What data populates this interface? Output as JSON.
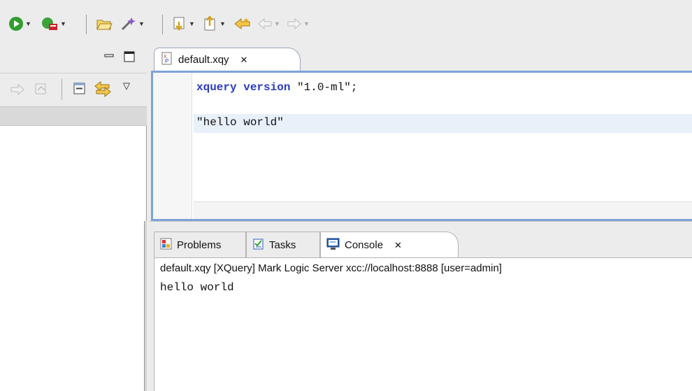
{
  "toolbar": {
    "icons": [
      "run-icon",
      "debug-server-icon",
      "open-folder-icon",
      "wand-icon",
      "next-annotation-icon",
      "prev-annotation-icon",
      "last-edit-icon",
      "back-icon",
      "forward-icon"
    ]
  },
  "left_panel": {
    "icons": [
      "minimize-icon",
      "maximize-icon",
      "forward-nav-icon",
      "home-icon",
      "collapse-all-icon",
      "link-editor-icon",
      "view-menu-icon"
    ]
  },
  "editor": {
    "tab_label": "default.xqy",
    "lines": [
      {
        "keyword": "xquery version",
        "rest": " \"1.0-ml\";"
      },
      {
        "text": "\"hello world\""
      }
    ]
  },
  "views": {
    "tabs": [
      {
        "label": "Problems",
        "icon": "problems-icon"
      },
      {
        "label": "Tasks",
        "icon": "tasks-icon"
      },
      {
        "label": "Console",
        "icon": "console-icon",
        "active": true
      }
    ],
    "console_header": "default.xqy [XQuery] Mark Logic Server xcc://localhost:8888 [user=admin]",
    "console_output": "hello world"
  },
  "colors": {
    "editor_border": "#7ea3d8",
    "keyword": "#2a3cc2",
    "highlight_line": "#e8f0fa",
    "run_green": "#2f9e2f"
  }
}
